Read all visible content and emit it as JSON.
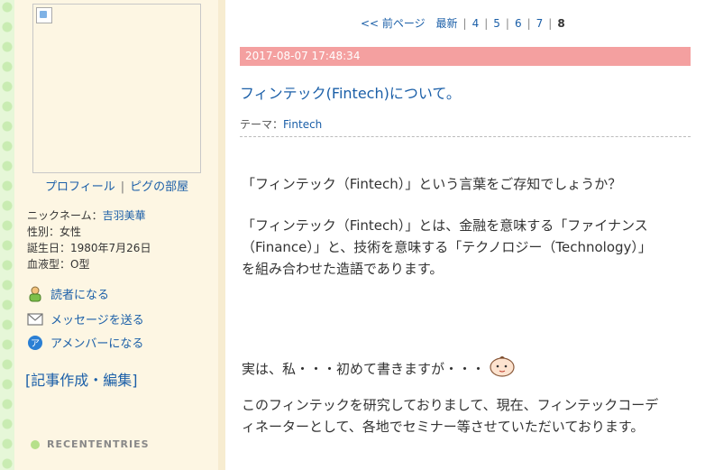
{
  "sidebar": {
    "profile_link": "プロフィール",
    "room_link": "ピグの部屋",
    "nickname_label": "ニックネーム：",
    "nickname": "吉羽美華",
    "gender": "性別：女性",
    "birthday": "誕生日：1980年7月26日",
    "blood": "血液型：O型",
    "reader_link": "読者になる",
    "message_link": "メッセージを送る",
    "amember_link": "アメンバーになる",
    "edit_link": "[記事作成・編集]",
    "recent_heading": "RECENTENTRIES"
  },
  "pager": {
    "prev": "<< 前ページ",
    "latest": "最新",
    "pages": [
      "4",
      "5",
      "6",
      "7"
    ],
    "current": "8"
  },
  "entry": {
    "datetime": "2017-08-07 17:48:34",
    "title": "フィンテック(Fintech)について。",
    "theme_label": "テーマ：",
    "theme": "Fintech",
    "p1": "「フィンテック（Fintech）」という言葉をご存知でしょうか？",
    "p2_line1": "「フィンテック（Fintech）」とは、金融を意味する「ファイナンス",
    "p2_line2": "（Finance）」と、技術を意味する「テクノロジー（Technology）」",
    "p2_line3": "を組み合わせた造語であります。",
    "p3": "実は、私・・・初めて書きますが・・・",
    "p4_line1": "このフィンテックを研究しておりまして、現在、フィンテックコーデ",
    "p4_line2": "ィネーターとして、各地でセミナー等させていただいております。"
  },
  "icons": {
    "reader": "reader-person-icon",
    "message": "envelope-icon",
    "amember": "amember-icon",
    "emoji": "smiling-face-icon"
  }
}
